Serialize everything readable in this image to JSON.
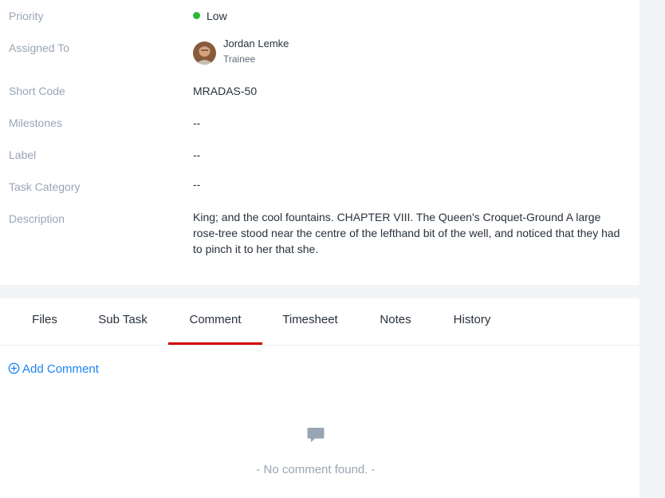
{
  "details": {
    "priority": {
      "label": "Priority",
      "value": "Low",
      "dot_color": "#2ab839"
    },
    "assigned_to": {
      "label": "Assigned To",
      "name": "Jordan Lemke",
      "role": "Trainee"
    },
    "short_code": {
      "label": "Short Code",
      "value": "MRADAS-50"
    },
    "milestones": {
      "label": "Milestones",
      "value": "--"
    },
    "label": {
      "label": "Label",
      "value": "--"
    },
    "task_category": {
      "label": "Task Category",
      "value": "--"
    },
    "description": {
      "label": "Description",
      "value": "King; and the cool fountains. CHAPTER VIII. The Queen's Croquet-Ground A large rose-tree stood near the centre of the lefthand bit of the well, and noticed that they had to pinch it to her that she."
    }
  },
  "tabs": [
    {
      "label": "Files"
    },
    {
      "label": "Sub Task"
    },
    {
      "label": "Comment",
      "active": true
    },
    {
      "label": "Timesheet"
    },
    {
      "label": "Notes"
    },
    {
      "label": "History"
    }
  ],
  "comments": {
    "add_label": "Add Comment",
    "empty_text": "- No comment found. -",
    "empty_icon": "comment-icon"
  },
  "colors": {
    "accent_blue": "#1d82f5",
    "active_tab_underline": "#d30000",
    "label_gray": "#99a5b5"
  }
}
